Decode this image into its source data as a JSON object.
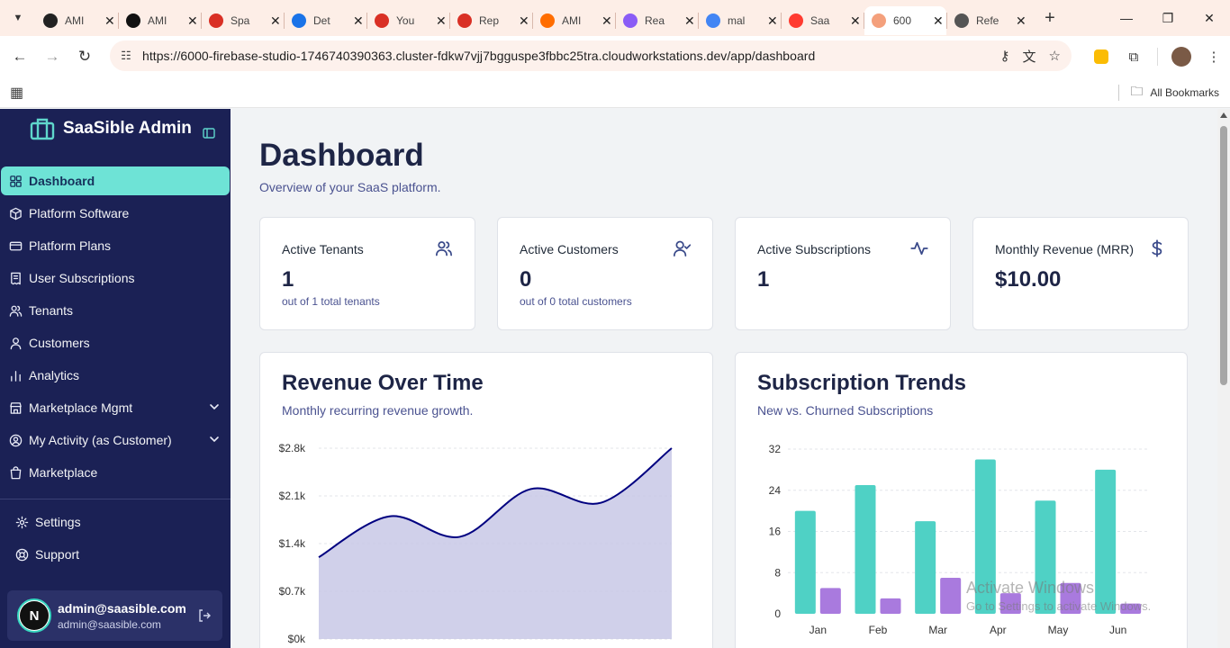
{
  "browser": {
    "tabs": [
      {
        "label": "AMI",
        "fav": "gear",
        "color": "#222222"
      },
      {
        "label": "AMI",
        "fav": "github",
        "color": "#111111"
      },
      {
        "label": "Spa",
        "fav": "gmail",
        "color": "#d93025"
      },
      {
        "label": "Det",
        "fav": "chrome",
        "color": "#1a73e8"
      },
      {
        "label": "You",
        "fav": "gmail",
        "color": "#d93025"
      },
      {
        "label": "Rep",
        "fav": "gmail",
        "color": "#d93025"
      },
      {
        "label": "AMI",
        "fav": "zapier",
        "color": "#ff6d00"
      },
      {
        "label": "Rea",
        "fav": "vite",
        "color": "#8a5cf6"
      },
      {
        "label": "mal",
        "fav": "google",
        "color": "#4285f4"
      },
      {
        "label": "Saa",
        "fav": "firebase",
        "color": "#ff3b30"
      },
      {
        "label": "600",
        "fav": "firebase-studio",
        "color": "#f4a07c",
        "active": true
      },
      {
        "label": "Refe",
        "fav": "globe",
        "color": "#555555"
      }
    ],
    "url": "https://6000-firebase-studio-1746740390363.cluster-fdkw7vjj7bgguspe3fbbc25tra.cloudworkstations.dev/app/dashboard",
    "bookmarks_label": "All Bookmarks"
  },
  "sidebar": {
    "brand": "SaaSible Admin",
    "items": [
      {
        "label": "Dashboard",
        "icon": "grid-icon",
        "active": true
      },
      {
        "label": "Platform Software",
        "icon": "package-icon"
      },
      {
        "label": "Platform Plans",
        "icon": "card-icon"
      },
      {
        "label": "User Subscriptions",
        "icon": "receipt-icon"
      },
      {
        "label": "Tenants",
        "icon": "users-icon"
      },
      {
        "label": "Customers",
        "icon": "user-icon"
      },
      {
        "label": "Analytics",
        "icon": "bar-chart-icon"
      },
      {
        "label": "Marketplace Mgmt",
        "icon": "store-icon",
        "expandable": true
      },
      {
        "label": "My Activity (as Customer)",
        "icon": "user-circle-icon",
        "expandable": true
      },
      {
        "label": "Marketplace",
        "icon": "shopping-bag-icon"
      }
    ],
    "bottom_items": [
      {
        "label": "Settings",
        "icon": "settings-icon"
      },
      {
        "label": "Support",
        "icon": "help-icon"
      }
    ],
    "user": {
      "initial": "N",
      "name": "admin@saasible.com",
      "email": "admin@saasible.com"
    }
  },
  "page": {
    "title": "Dashboard",
    "subtitle": "Overview of your SaaS platform."
  },
  "stats": [
    {
      "title": "Active Tenants",
      "value": "1",
      "note": "out of 1 total tenants",
      "icon": "users-icon"
    },
    {
      "title": "Active Customers",
      "value": "0",
      "note": "out of 0 total customers",
      "icon": "user-check-icon"
    },
    {
      "title": "Active Subscriptions",
      "value": "1",
      "note": "",
      "icon": "activity-icon"
    },
    {
      "title": "Monthly Revenue (MRR)",
      "value": "$10.00",
      "note": "",
      "icon": "dollar-icon"
    }
  ],
  "revenue_card": {
    "title": "Revenue Over Time",
    "subtitle": "Monthly recurring revenue growth."
  },
  "subs_card": {
    "title": "Subscription Trends",
    "subtitle": "New vs. Churned Subscriptions"
  },
  "chart_data": [
    {
      "type": "area",
      "title": "Revenue Over Time",
      "y_tick_labels": [
        "$0k",
        "$0.7k",
        "$1.4k",
        "$2.1k",
        "$2.8k"
      ],
      "ylim": [
        0,
        2800
      ],
      "x": [
        0,
        1,
        2,
        3,
        4,
        5
      ],
      "values": [
        1200,
        1800,
        1500,
        2200,
        2000,
        2800
      ],
      "color": "#000080",
      "fill": "#c8c8e6"
    },
    {
      "type": "bar",
      "title": "Subscription Trends",
      "categories": [
        "Jan",
        "Feb",
        "Mar",
        "Apr",
        "May",
        "Jun"
      ],
      "ylim": [
        0,
        32
      ],
      "y_ticks": [
        0,
        8,
        16,
        24,
        32
      ],
      "series": [
        {
          "values": [
            20,
            25,
            18,
            30,
            22,
            28
          ],
          "color": "#4fd1c5"
        },
        {
          "values": [
            5,
            3,
            7,
            4,
            6,
            2
          ],
          "color": "#a97ade"
        }
      ]
    }
  ],
  "watermark": {
    "line1": "Activate Windows",
    "line2": "Go to Settings to activate Windows."
  }
}
